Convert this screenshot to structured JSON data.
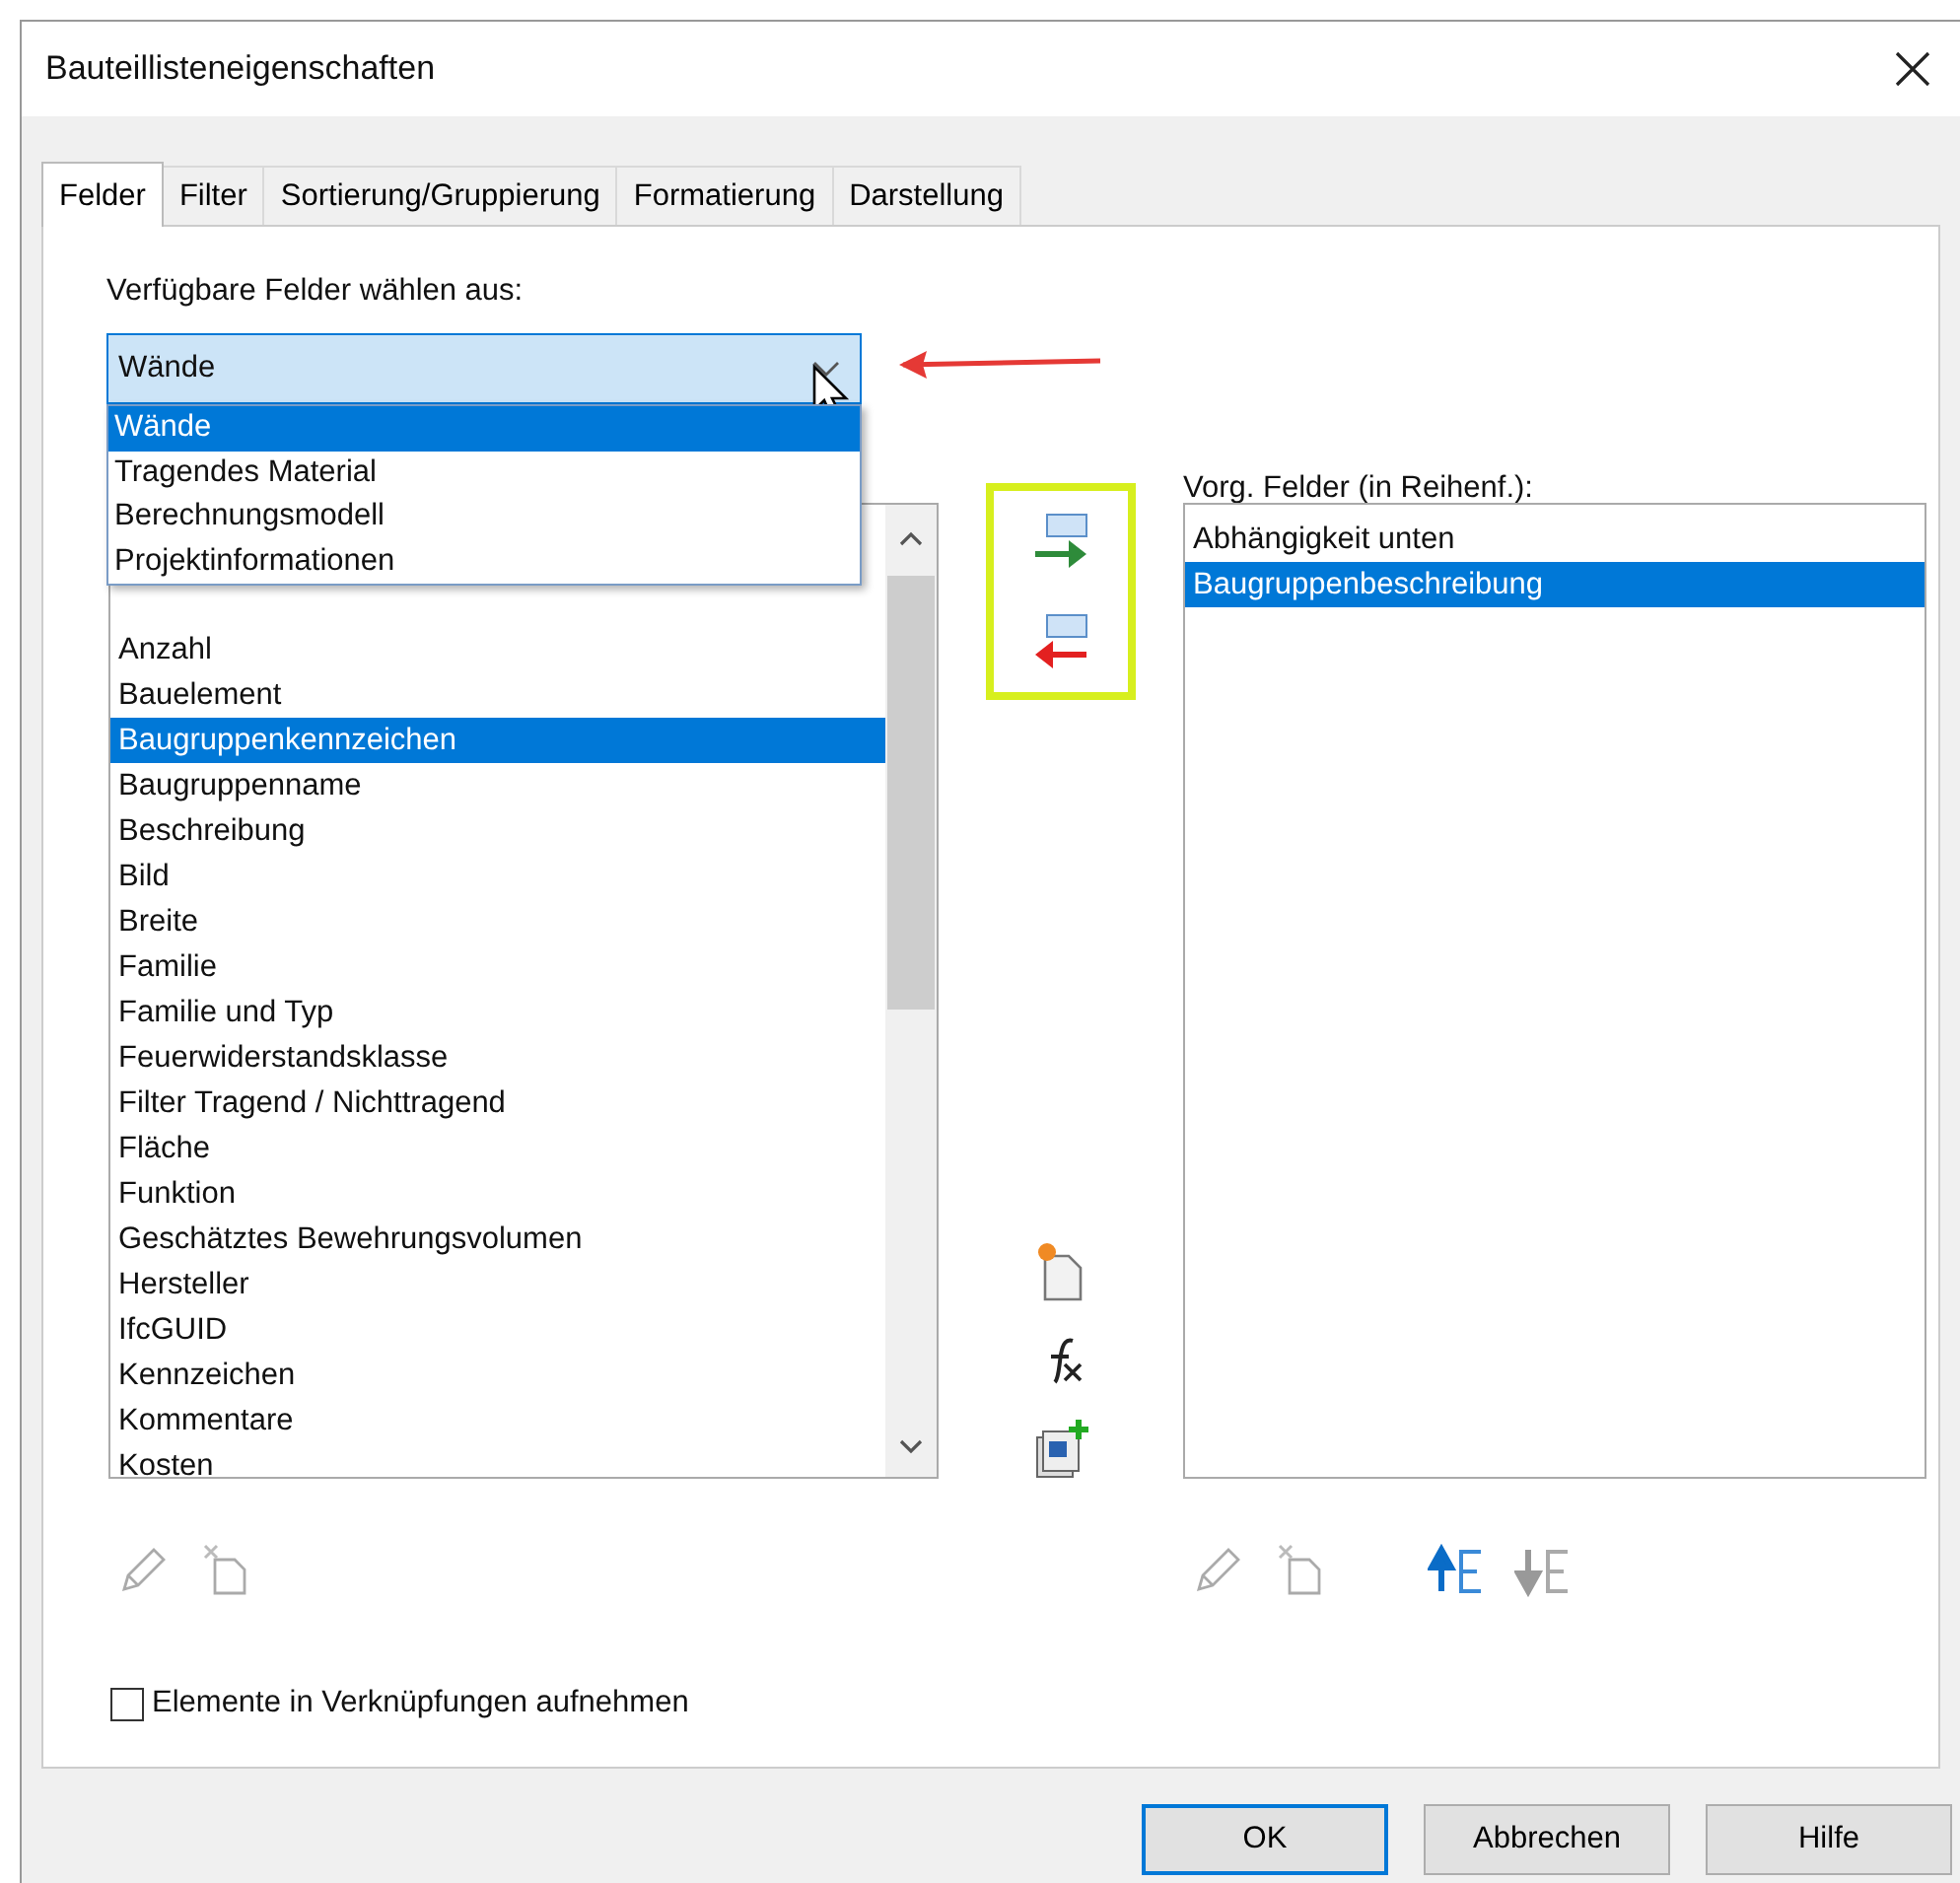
{
  "window": {
    "title": "Bauteillisteneigenschaften"
  },
  "tabs": [
    {
      "label": "Felder",
      "selected": true
    },
    {
      "label": "Filter",
      "selected": false
    },
    {
      "label": "Sortierung/Gruppierung",
      "selected": false
    },
    {
      "label": "Formatierung",
      "selected": false
    },
    {
      "label": "Darstellung",
      "selected": false
    }
  ],
  "source": {
    "label": "Verfügbare Felder wählen aus:",
    "dropdown": {
      "value": "Wände",
      "expanded": true,
      "options": [
        {
          "label": "Wände",
          "selected": true
        },
        {
          "label": "Tragendes Material",
          "selected": false
        },
        {
          "label": "Berechnungsmodell",
          "selected": false
        },
        {
          "label": "Projektinformationen",
          "selected": false
        }
      ]
    }
  },
  "available_fields": {
    "items": [
      {
        "label": "Anzahl",
        "selected": false
      },
      {
        "label": "Bauelement",
        "selected": false
      },
      {
        "label": "Baugruppenkennzeichen",
        "selected": true
      },
      {
        "label": "Baugruppenname",
        "selected": false
      },
      {
        "label": "Beschreibung",
        "selected": false
      },
      {
        "label": "Bild",
        "selected": false
      },
      {
        "label": "Breite",
        "selected": false
      },
      {
        "label": "Familie",
        "selected": false
      },
      {
        "label": "Familie und Typ",
        "selected": false
      },
      {
        "label": "Feuerwiderstandsklasse",
        "selected": false
      },
      {
        "label": "Filter Tragend / Nichttragend",
        "selected": false
      },
      {
        "label": "Fläche",
        "selected": false
      },
      {
        "label": "Funktion",
        "selected": false
      },
      {
        "label": "Geschätztes Bewehrungsvolumen",
        "selected": false
      },
      {
        "label": "Hersteller",
        "selected": false
      },
      {
        "label": "IfcGUID",
        "selected": false
      },
      {
        "label": "Kennzeichen",
        "selected": false
      },
      {
        "label": "Kommentare",
        "selected": false
      },
      {
        "label": "Kosten",
        "selected": false
      }
    ]
  },
  "scheduled_fields": {
    "label": "Vorg. Felder (in Reihenf.):",
    "items": [
      {
        "label": "Abhängigkeit unten",
        "selected": false
      },
      {
        "label": "Baugruppenbeschreibung",
        "selected": true
      }
    ]
  },
  "include_links": {
    "label": "Elemente in Verknüpfungen aufnehmen",
    "checked": false
  },
  "buttons": [
    {
      "label": "OK",
      "default": true
    },
    {
      "label": "Abbrechen",
      "default": false
    },
    {
      "label": "Hilfe",
      "default": false
    }
  ]
}
